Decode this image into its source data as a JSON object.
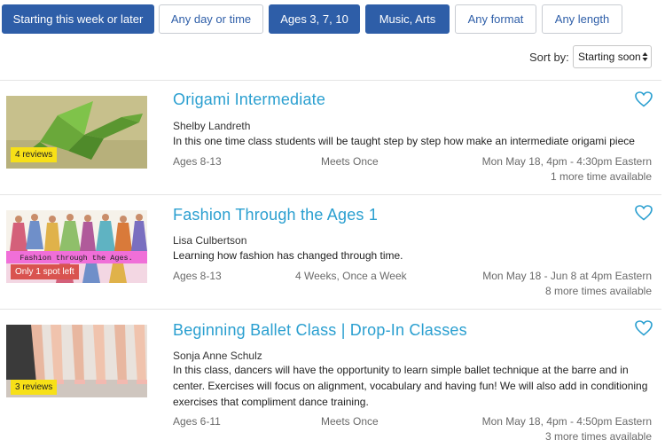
{
  "filters": [
    {
      "label": "Starting this week or later",
      "active": true
    },
    {
      "label": "Any day or time",
      "active": false
    },
    {
      "label": "Ages 3, 7, 10",
      "active": true
    },
    {
      "label": "Music, Arts",
      "active": true
    },
    {
      "label": "Any format",
      "active": false
    },
    {
      "label": "Any length",
      "active": false
    }
  ],
  "sort": {
    "label": "Sort by:",
    "selected": "Starting soon"
  },
  "listings": [
    {
      "title": "Origami Intermediate",
      "teacher": "Shelby Landreth",
      "description": "In this one time class students will be taught step by step how make an intermediate origami piece",
      "ages": "Ages 8-13",
      "frequency": "Meets Once",
      "schedule": "Mon May 18, 4pm - 4:30pm Eastern",
      "more_times": "1 more time available",
      "badge": "4 reviews",
      "image_text": ""
    },
    {
      "title": "Fashion Through the Ages 1",
      "teacher": "Lisa Culbertson",
      "description": "Learning how fashion has changed through time.",
      "ages": "Ages 8-13",
      "frequency": "4 Weeks, Once a Week",
      "schedule": "Mon May 18 - Jun 8 at 4pm Eastern",
      "more_times": "8 more times available",
      "badge": "Only 1 spot left",
      "image_text": "Fashion through the Ages."
    },
    {
      "title": "Beginning Ballet Class | Drop-In Classes",
      "teacher": "Sonja Anne Schulz",
      "description": "In this class, dancers will have the opportunity to learn simple ballet technique at the barre and in center. Exercises will focus on alignment, vocabulary and having fun! We will also add in conditioning exercises that compliment dance training.",
      "ages": "Ages 6-11",
      "frequency": "Meets Once",
      "schedule": "Mon May 18, 4pm - 4:50pm Eastern",
      "more_times": "3 more times available",
      "badge": "3 reviews",
      "image_text": ""
    }
  ],
  "colors": {
    "accent": "#2e5ea8",
    "title": "#2a9fd0",
    "review_badge": "#f7e017",
    "spot_badge": "#d9534f"
  }
}
